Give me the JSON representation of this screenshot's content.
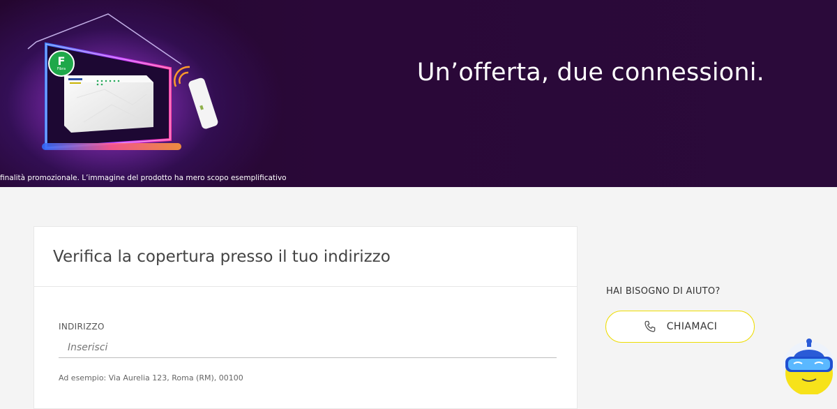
{
  "hero": {
    "headline": "Un’offerta, due connessioni.",
    "disclaimer": "finalità promozionale. L’immagine del prodotto ha mero scopo esemplificativo",
    "badge_letter": "F",
    "badge_sub": "Fibra"
  },
  "coverage": {
    "title": "Verifica la copertura presso il tuo indirizzo",
    "address_label": "INDIRIZZO",
    "address_placeholder": "Inserisci",
    "address_value": "",
    "hint": "Ad esempio: Via Aurelia 123, Roma (RM), 00100"
  },
  "help": {
    "title": "HAI BISOGNO DI AIUTO?",
    "call_label": "CHIAMACI",
    "call_icon": "phone-icon"
  },
  "assistant": {
    "icon": "chatbot-assistant-icon"
  },
  "colors": {
    "hero_bg": "#2a0838",
    "accent_yellow": "#eedc00",
    "badge_green": "#1fa84a",
    "page_bg": "#f4f4f4"
  }
}
